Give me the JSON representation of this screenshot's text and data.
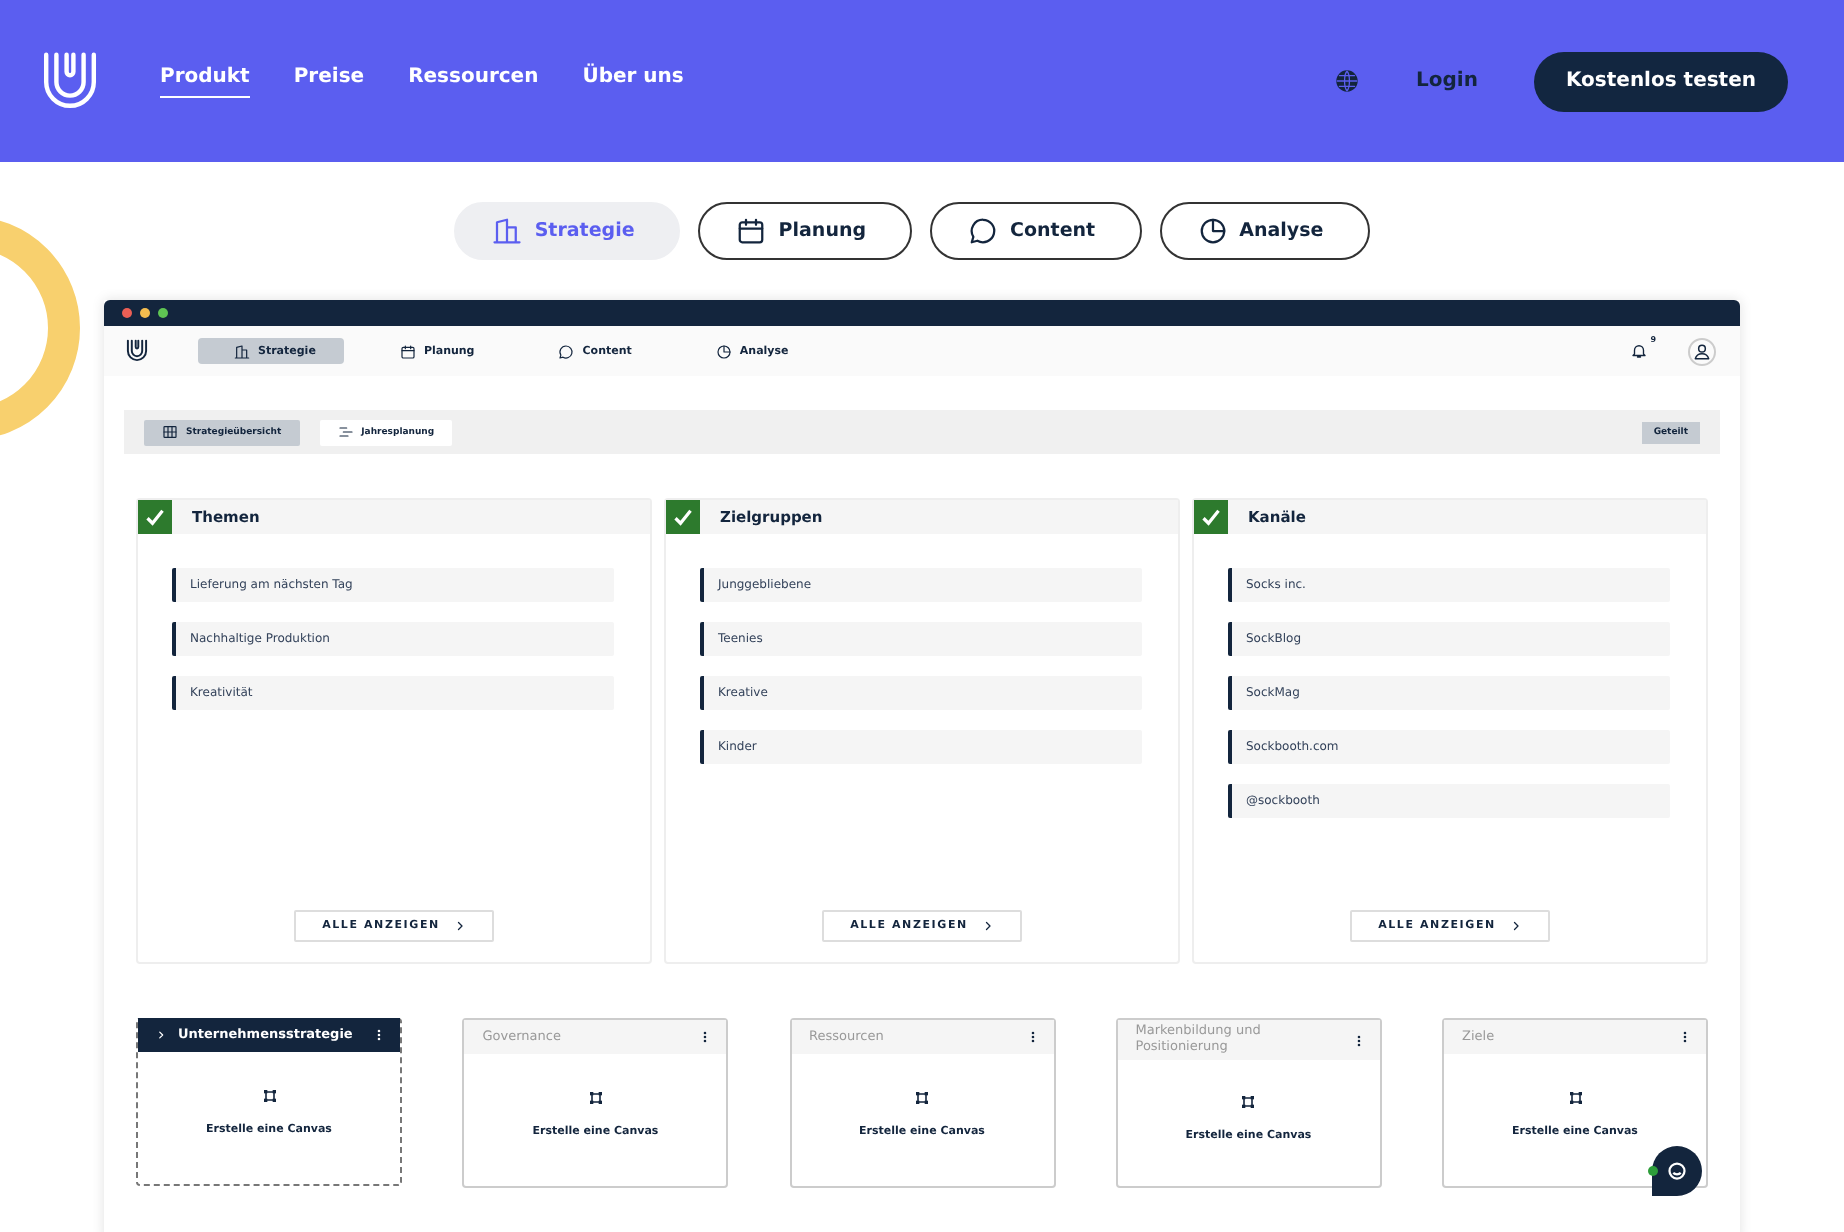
{
  "header": {
    "nav": [
      {
        "label": "Produkt",
        "selected": true
      },
      {
        "label": "Preise",
        "selected": false
      },
      {
        "label": "Ressourcen",
        "selected": false
      },
      {
        "label": "Über uns",
        "selected": false
      }
    ],
    "login": "Login",
    "cta": "Kostenlos testen"
  },
  "tabs": [
    {
      "label": "Strategie",
      "selected": true
    },
    {
      "label": "Planung",
      "selected": false
    },
    {
      "label": "Content",
      "selected": false
    },
    {
      "label": "Analyse",
      "selected": false
    }
  ],
  "app": {
    "nav": [
      {
        "label": "Strategie",
        "selected": true
      },
      {
        "label": "Planung",
        "selected": false
      },
      {
        "label": "Content",
        "selected": false
      },
      {
        "label": "Analyse",
        "selected": false
      }
    ],
    "notifications": "9",
    "subtabs": [
      {
        "label": "Strategieübersicht",
        "selected": true
      },
      {
        "label": "Jahresplanung",
        "selected": false
      }
    ],
    "share": "Geteilt",
    "columns": [
      {
        "title": "Themen",
        "checked": true,
        "items": [
          "Lieferung am nächsten Tag",
          "Nachhaltige Produktion",
          "Kreativität"
        ],
        "button": "ALLE ANZEIGEN"
      },
      {
        "title": "Zielgruppen",
        "checked": true,
        "items": [
          "Junggebliebene",
          "Teenies",
          "Kreative",
          "Kinder"
        ],
        "button": "ALLE ANZEIGEN"
      },
      {
        "title": "Kanäle",
        "checked": true,
        "items": [
          "Socks inc.",
          "SockBlog",
          "SockMag",
          "Sockbooth.com",
          "@sockbooth"
        ],
        "button": "ALLE ANZEIGEN"
      }
    ],
    "canvases": [
      {
        "title": "Unternehmensstrategie",
        "selected": true,
        "action": "Erstelle eine Canvas"
      },
      {
        "title": "Governance",
        "selected": false,
        "action": "Erstelle eine Canvas"
      },
      {
        "title": "Ressourcen",
        "selected": false,
        "action": "Erstelle eine Canvas"
      },
      {
        "title": "Markenbildung und Positionierung",
        "selected": false,
        "action": "Erstelle eine Canvas"
      },
      {
        "title": "Ziele",
        "selected": false,
        "action": "Erstelle eine Canvas"
      }
    ]
  }
}
